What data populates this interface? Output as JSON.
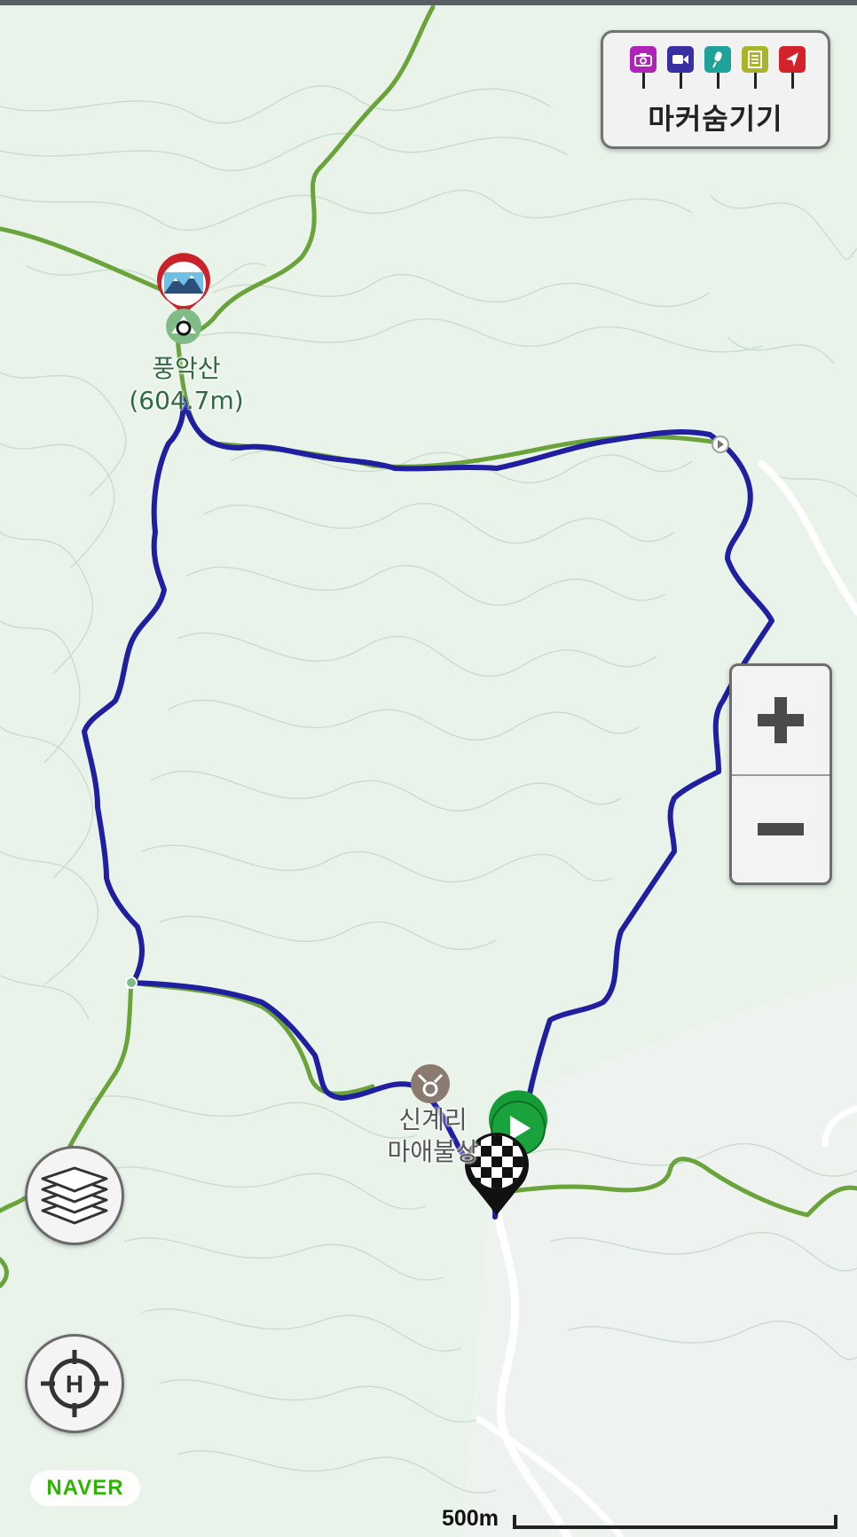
{
  "map": {
    "provider": "NAVER",
    "peak": {
      "name": "풍악산",
      "elevation": "(604.7m)"
    },
    "poi": {
      "line1": "신계리",
      "line2": "마애불상"
    },
    "scale": {
      "label": "500m"
    },
    "route_color": "#1f1fa0",
    "trail_color": "#6aa33a",
    "road_color": "#ffffff",
    "land_color": "#e9f3ea"
  },
  "marker_panel": {
    "label": "마커숨기기",
    "icons": [
      {
        "name": "camera-icon",
        "color": "#b023b8"
      },
      {
        "name": "video-icon",
        "color": "#3a2fa2"
      },
      {
        "name": "microphone-icon",
        "color": "#1fa29a"
      },
      {
        "name": "memo-icon",
        "color": "#a8b52a"
      },
      {
        "name": "flag-icon",
        "color": "#d2232a"
      }
    ]
  },
  "controls": {
    "zoom_in": "zoom-in",
    "zoom_out": "zoom-out",
    "layers": "layers",
    "home": "home-location"
  }
}
